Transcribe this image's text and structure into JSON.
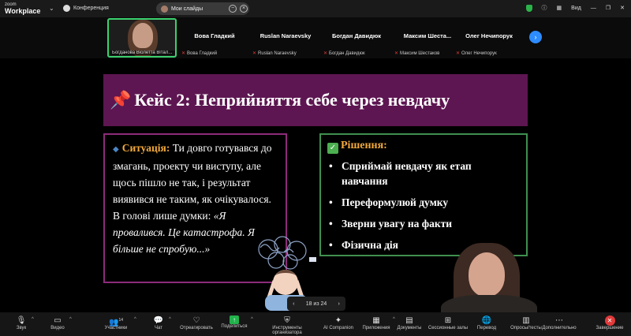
{
  "titlebar": {
    "logo_top": "zoom",
    "logo_bottom": "Workplace",
    "meeting_label": "Конференция",
    "share_title": "Мои слайды",
    "view_label": "Вид"
  },
  "gallery": {
    "self_name": "Богданова Віолетта Вітал...",
    "participants": [
      {
        "name": "Вова Гладкий",
        "label": "Вова Гладкий"
      },
      {
        "name": "Ruslan Naraevsky",
        "label": "Ruslan Naraevsky"
      },
      {
        "name": "Богдан Давидюк",
        "label": "Богдан Давидюк"
      },
      {
        "name": "Максим Шеста...",
        "label": "Максим Шестаков"
      },
      {
        "name": "Олег Нечипорук",
        "label": "Олег Нечипорук"
      }
    ]
  },
  "slide": {
    "title": "Кейс 2: Неприйняття себе через невдачу",
    "situation_head": "Ситуація:",
    "situation_text": " Ти довго готувався до змагань, проекту чи виступу, але щось пішло не так, і результат виявився не таким, як очікувалося. В голові лише думки: ",
    "situation_quote": "«Я провалився. Це катастрофа. Я більше не спробую...»",
    "solution_head": "Рішення:",
    "solutions": [
      "Сприймай невдачу як етап навчання",
      "Переформулюй думку",
      "Зверни увагу на факти",
      "Фізична дія"
    ],
    "page_indicator": "18 из 24"
  },
  "toolbar": {
    "audio": "Звук",
    "video": "Видео",
    "participants": "Участники",
    "participants_count": "14",
    "chat": "Чат",
    "react": "Отреагировать",
    "share": "Поделиться",
    "host_tools": "Инструменты организатора",
    "ai": "AI Companion",
    "apps": "Приложения",
    "docs": "Документы",
    "breakout": "Сессионные залы",
    "translate": "Перевод",
    "polls": "Опросы/тесты",
    "more": "Дополнительно",
    "end": "Завершение"
  }
}
